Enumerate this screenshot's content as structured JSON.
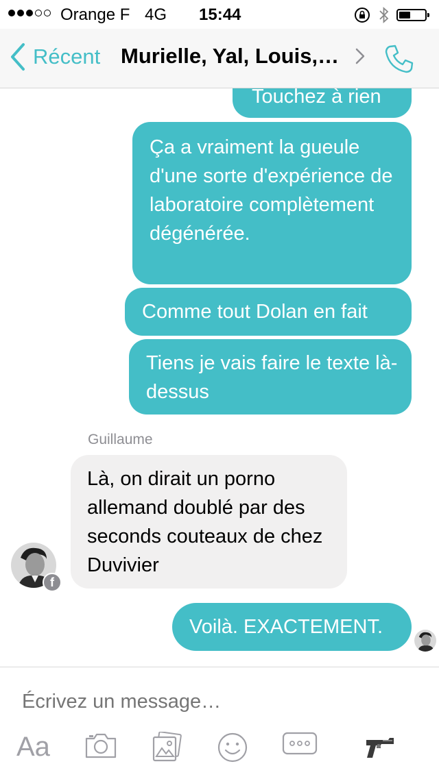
{
  "status_bar": {
    "carrier": "Orange F",
    "network": "4G",
    "time": "15:44",
    "signal_bars": 3,
    "signal_total": 5
  },
  "nav": {
    "back_label": "Récent",
    "title": "Murielle, Yal, Louis,…",
    "accent_color": "#44bec7"
  },
  "messages": [
    {
      "from": "me",
      "text": "Touchez à rien"
    },
    {
      "from": "me",
      "text": "Ça a vraiment la gueule d'une sorte d'expérience de laboratoire complètement dégénérée."
    },
    {
      "from": "me",
      "text": "Comme tout Dolan en fait"
    },
    {
      "from": "me",
      "text": "Tiens je vais faire le texte là-dessus"
    },
    {
      "from": "Guillaume",
      "sender_label": "Guillaume",
      "text": "Là, on dirait un porno allemand doublé par des seconds couteaux de chez Duvivier"
    },
    {
      "from": "me",
      "text": "Voilà. EXACTEMENT."
    }
  ],
  "composer": {
    "placeholder": "Écrivez un message…",
    "aa_label": "Aa",
    "icons": [
      "camera-icon",
      "gallery-icon",
      "emoji-icon",
      "more-icon",
      "gun-emoji-icon"
    ]
  }
}
